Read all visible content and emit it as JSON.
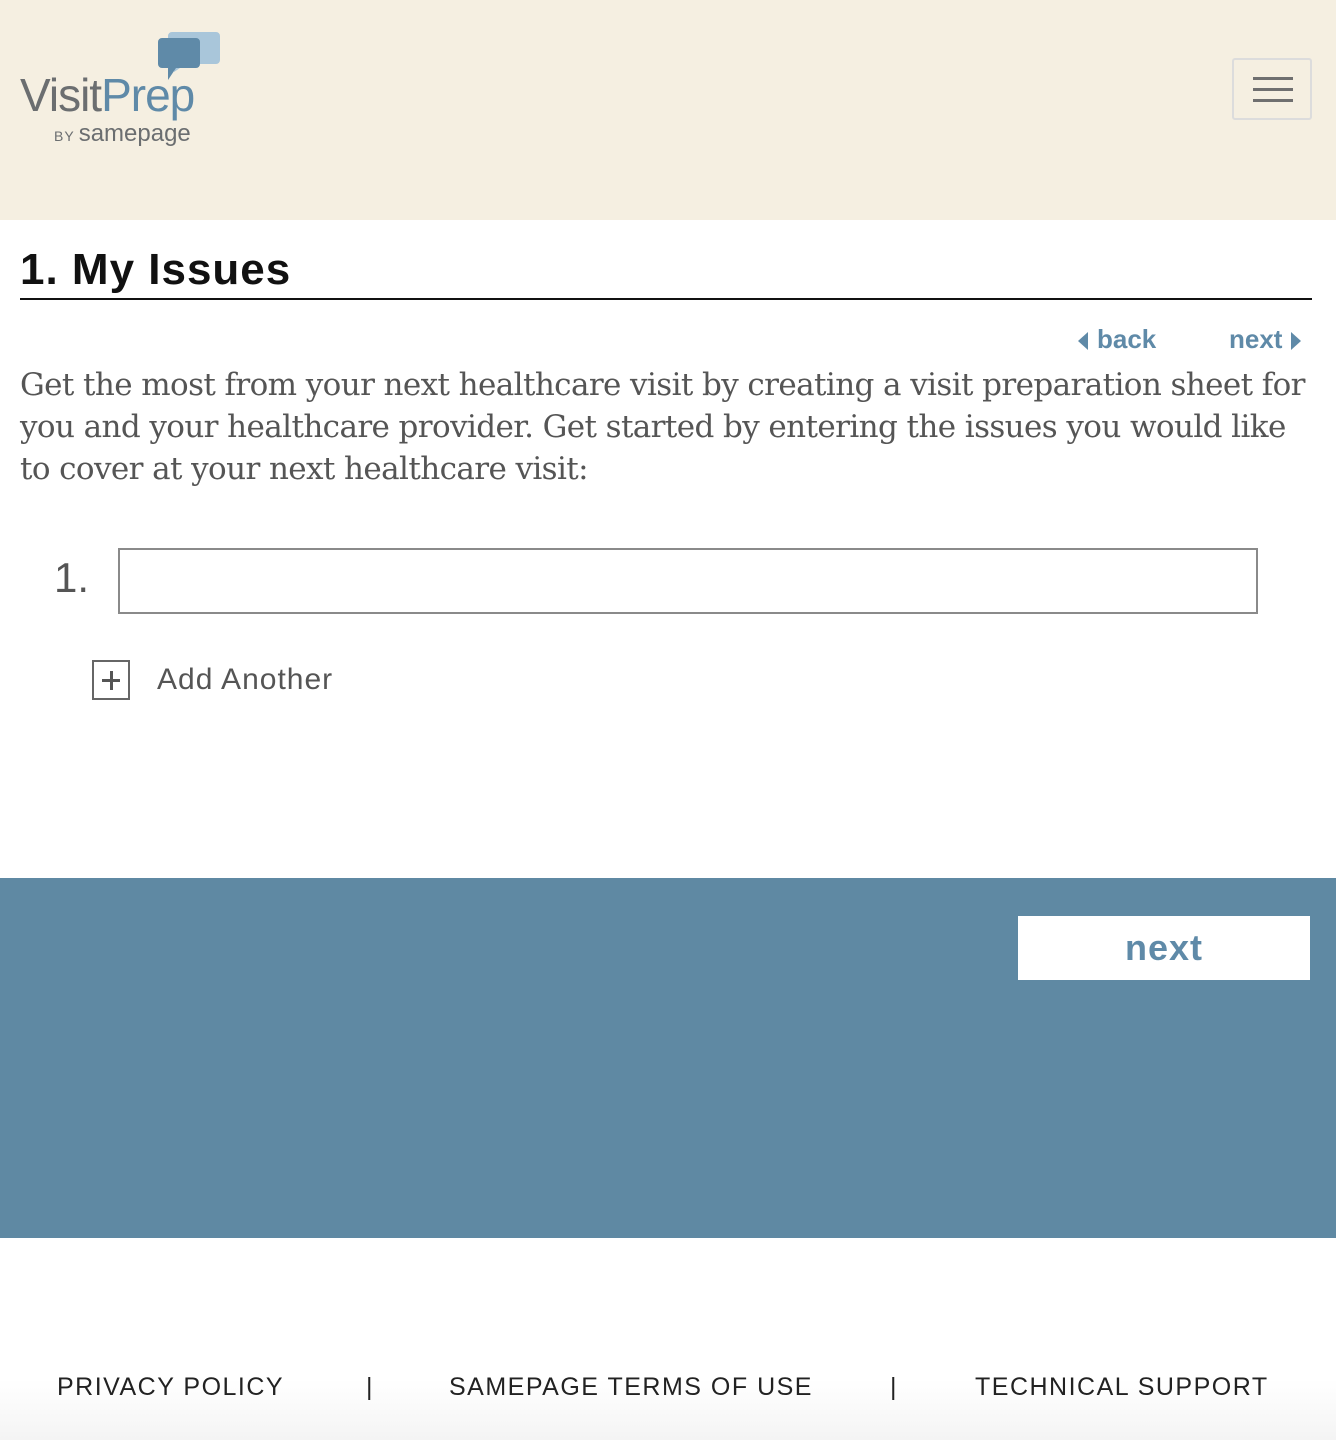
{
  "header": {
    "logo": {
      "visit": "Visit",
      "prep": "Prep",
      "by": "BY",
      "samepage": "samepage"
    },
    "menu_icon": "hamburger-menu-icon"
  },
  "main": {
    "title": "1. My Issues",
    "pager": {
      "back_label": "back",
      "next_label": "next"
    },
    "intro": "Get the most from your next healthcare visit by creating a visit preparation sheet for you and your healthcare provider. Get started by entering the issues you would like to cover at your next healthcare visit:",
    "issues": [
      {
        "number": "1.",
        "value": "",
        "placeholder": ""
      }
    ],
    "add_another_label": "Add Another"
  },
  "action_band": {
    "next_label": "next"
  },
  "footer": {
    "links": [
      "PRIVACY POLICY",
      "SAMEPAGE TERMS OF USE",
      "TECHNICAL SUPPORT"
    ],
    "separator": "|"
  },
  "colors": {
    "header_bg": "#f5efe1",
    "accent_blue": "#5f8aa8",
    "band_blue": "#5f89a3",
    "text_gray": "#555555"
  }
}
